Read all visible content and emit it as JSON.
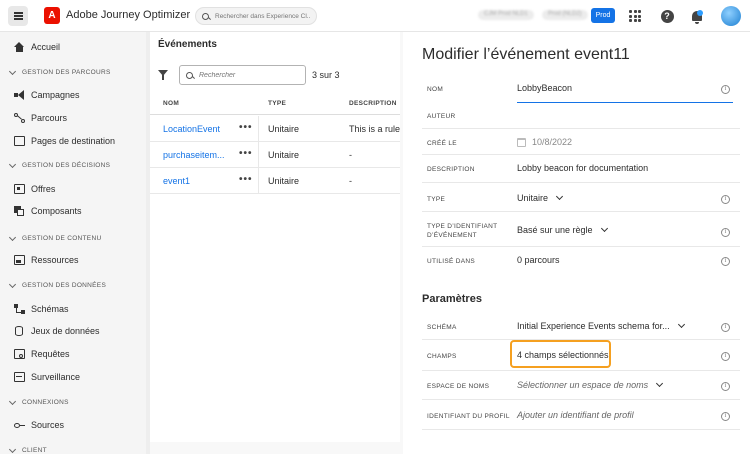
{
  "topbar": {
    "app_title": "Adobe Journey Optimizer",
    "search_placeholder": "Rechercher dans Experience Cl...",
    "blurred_1": "CJM Prod NLD1",
    "blurred_2": "Prod (NLD2)",
    "env_button": "Prod",
    "adobe_logo": "A"
  },
  "nav": {
    "home": "Accueil",
    "sections": {
      "journeys": "GESTION DES PARCOURS",
      "decisions": "GESTION DES DÉCISIONS",
      "content": "GESTION DE CONTENU",
      "data": "GESTION DES DONNÉES",
      "connections": "CONNEXIONS",
      "client": "CLIENT"
    },
    "items": {
      "campaigns": "Campagnes",
      "journeys": "Parcours",
      "landing_pages": "Pages de destination",
      "offers": "Offres",
      "components": "Composants",
      "assets": "Ressources",
      "schemas": "Schémas",
      "datasets": "Jeux de données",
      "queries": "Requêtes",
      "monitoring": "Surveillance",
      "sources": "Sources"
    }
  },
  "events": {
    "title": "Événements",
    "search_placeholder": "Rechercher",
    "count": "3 sur 3",
    "columns": {
      "name": "NOM",
      "type": "TYPE",
      "description": "DESCRIPTION"
    },
    "rows": [
      {
        "name": "LocationEvent",
        "more": "•••",
        "type": "Unitaire",
        "description": "This is a rule-b"
      },
      {
        "name": "purchaseitem...",
        "more": "•••",
        "type": "Unitaire",
        "description": "-"
      },
      {
        "name": "event1",
        "more": "•••",
        "type": "Unitaire",
        "description": "-"
      }
    ]
  },
  "edit": {
    "title": "Modifier l’événement event11",
    "info_glyph": "i",
    "fields": {
      "name_label": "NOM",
      "name_value": "LobbyBeacon",
      "author_label": "AUTEUR",
      "created_label": "CRÉÉ LE",
      "created_value": "10/8/2022",
      "description_label": "DESCRIPTION",
      "description_value": "Lobby beacon for documentation",
      "type_label": "TYPE",
      "type_value": "Unitaire",
      "id_type_label_1": "TYPE D’IDENTIFIANT",
      "id_type_label_2": "D’ÉVÉNEMENT",
      "id_type_value": "Basé sur une règle",
      "used_in_label": "UTILISÉ DANS",
      "used_in_value": "0 parcours"
    },
    "params": {
      "title": "Paramètres",
      "schema_label": "SCHÉMA",
      "schema_value": "Initial Experience Events schema for...",
      "fields_label": "CHAMPS",
      "fields_value": "4 champs sélectionnés",
      "namespace_label": "ESPACE DE NOMS",
      "namespace_value": "Sélectionner un espace de noms",
      "profile_id_label": "IDENTIFIANT DU PROFIL",
      "profile_id_placeholder": "Ajouter un identifiant de profil"
    }
  },
  "colors": {
    "accent": "#1473e6",
    "highlight": "#f5a020",
    "adobe_red": "#eb1000"
  }
}
